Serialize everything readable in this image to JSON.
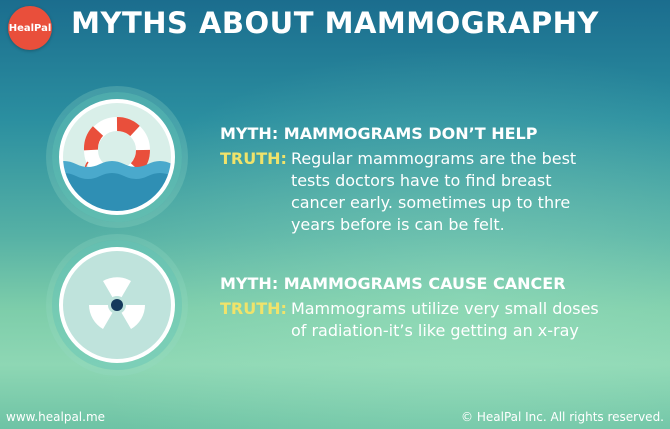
{
  "logo": {
    "text": "HealPal"
  },
  "header": {
    "title": "MYTHS ABOUT MAMMOGRAPHY"
  },
  "items": [
    {
      "icon": "lifebuoy-icon",
      "myth": "MYTH: MAMMOGRAMS DON’T HELP",
      "truth_label": "TRUTH:",
      "truth_text": "Regular mammograms are the best tests doctors have to find breast cancer early. sometimes up to thre years before is can be felt."
    },
    {
      "icon": "radiation-icon",
      "myth": "MYTH: MAMMOGRAMS CAUSE CANCER",
      "truth_label": "TRUTH:",
      "truth_text": "Mammograms utilize very small doses of radiation-it’s like getting an x-ray"
    }
  ],
  "footer": {
    "website": "www.healpal.me",
    "copyright": "© HealPal Inc. All rights reserved."
  },
  "colors": {
    "accent_truth": "#f0e36a",
    "logo_red": "#e94f3b",
    "lifebuoy_red": "#e94f3b",
    "water_blue": "#2f8fb4"
  }
}
